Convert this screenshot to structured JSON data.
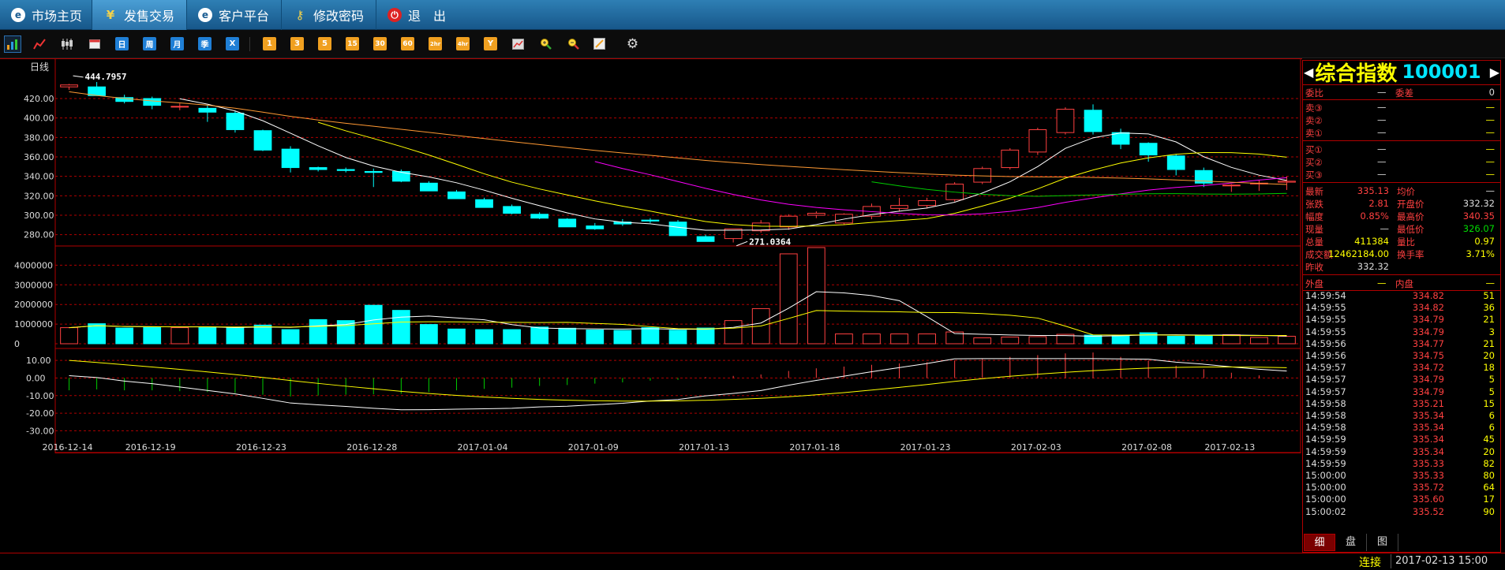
{
  "nav": {
    "items": [
      {
        "label": "市场主页",
        "icon": "market-home-icon"
      },
      {
        "label": "发售交易",
        "icon": "yen-icon"
      },
      {
        "label": "客户平台",
        "icon": "client-platform-icon"
      },
      {
        "label": "修改密码",
        "icon": "key-icon"
      },
      {
        "label": "退　出",
        "icon": "power-icon"
      }
    ],
    "active_index": 1
  },
  "toolbar": {
    "period_buttons": [
      "日",
      "周",
      "月",
      "季",
      "X"
    ],
    "minute_buttons": [
      "1",
      "3",
      "5",
      "15",
      "30",
      "60",
      "2hr",
      "4hr",
      "Y"
    ]
  },
  "chart_data": [
    {
      "type": "candlestick",
      "period_label": "日线",
      "x": [
        "2016-12-14",
        "2016-12-15",
        "2016-12-16",
        "2016-12-19",
        "2016-12-20",
        "2016-12-21",
        "2016-12-22",
        "2016-12-23",
        "2016-12-26",
        "2016-12-27",
        "2016-12-28",
        "2016-12-29",
        "2016-12-30",
        "2017-01-03",
        "2017-01-04",
        "2017-01-05",
        "2017-01-06",
        "2017-01-09",
        "2017-01-10",
        "2017-01-11",
        "2017-01-12",
        "2017-01-13",
        "2017-01-16",
        "2017-01-17",
        "2017-01-18",
        "2017-01-19",
        "2017-01-20",
        "2017-01-23",
        "2017-01-24",
        "2017-01-25",
        "2017-01-26",
        "2017-01-27",
        "2017-01-31",
        "2017-02-01",
        "2017-02-02",
        "2017-02-03",
        "2017-02-06",
        "2017-02-07",
        "2017-02-08",
        "2017-02-09",
        "2017-02-10",
        "2017-02-13"
      ],
      "x_tick_labels": [
        "2016-12-14",
        "2016-12-19",
        "2016-12-23",
        "2016-12-28",
        "2017-01-04",
        "2017-01-09",
        "2017-01-13",
        "2017-01-18",
        "2017-01-23",
        "2017-02-03",
        "2017-02-08",
        "2017-02-13"
      ],
      "x_tick_indices": [
        0,
        3,
        7,
        11,
        15,
        19,
        23,
        27,
        31,
        35,
        39,
        42
      ],
      "ylim": [
        270,
        450
      ],
      "yticks": [
        "420.00",
        "400.00",
        "380.00",
        "360.00",
        "340.00",
        "320.00",
        "300.00",
        "280.00"
      ],
      "ohlc": [
        [
          432,
          435,
          429,
          434
        ],
        [
          432,
          437,
          424,
          423
        ],
        [
          421,
          424,
          415,
          417
        ],
        [
          420,
          422,
          409,
          413
        ],
        [
          412,
          415,
          408,
          412
        ],
        [
          410,
          413,
          396,
          406
        ],
        [
          405,
          407,
          385,
          388
        ],
        [
          387,
          388,
          366,
          367
        ],
        [
          368,
          371,
          344,
          349
        ],
        [
          349,
          350,
          345,
          347
        ],
        [
          347,
          349,
          344,
          346
        ],
        [
          345,
          348,
          329,
          344
        ],
        [
          345,
          347,
          334,
          335
        ],
        [
          333,
          335,
          326,
          325
        ],
        [
          324,
          326,
          318,
          317
        ],
        [
          316,
          318,
          309,
          308
        ],
        [
          309,
          311,
          301,
          302
        ],
        [
          301,
          303,
          296,
          297
        ],
        [
          296,
          297,
          288,
          288
        ],
        [
          289,
          292,
          285,
          286
        ],
        [
          293,
          296,
          289,
          291
        ],
        [
          295,
          297,
          292,
          294
        ],
        [
          293,
          295,
          290,
          279
        ],
        [
          278,
          280,
          274,
          273
        ],
        [
          276,
          286,
          272,
          286
        ],
        [
          284,
          295,
          282,
          292
        ],
        [
          288,
          301,
          285,
          299
        ],
        [
          300,
          304,
          297,
          302
        ],
        [
          292,
          302,
          290,
          301
        ],
        [
          299,
          312,
          296,
          309
        ],
        [
          307,
          318,
          304,
          310
        ],
        [
          310,
          318,
          307,
          315
        ],
        [
          316,
          334,
          314,
          332
        ],
        [
          334,
          350,
          332,
          348
        ],
        [
          349,
          369,
          347,
          367
        ],
        [
          365,
          390,
          362,
          388
        ],
        [
          385,
          411,
          383,
          409
        ],
        [
          408,
          414,
          383,
          386
        ],
        [
          385,
          389,
          368,
          373
        ],
        [
          374,
          375,
          355,
          362
        ],
        [
          361,
          363,
          341,
          347
        ],
        [
          346,
          349,
          329,
          333
        ],
        [
          331,
          332,
          324,
          331
        ],
        [
          333,
          336,
          325,
          333
        ],
        [
          334,
          340,
          326,
          335
        ]
      ],
      "annotations": [
        {
          "label": "444.7957"
        },
        {
          "label": "271.0364"
        }
      ],
      "ma_series": [
        {
          "color": "#ffffff"
        },
        {
          "color": "#ffff00"
        },
        {
          "color": "#ff00ff"
        },
        {
          "color": "#00cc00"
        },
        {
          "color": "#ff9933"
        }
      ]
    },
    {
      "type": "bar",
      "yticks": [
        "4000000",
        "3000000",
        "2000000",
        "1000000",
        "0"
      ],
      "ylim": [
        0,
        4900000
      ],
      "values": [
        820000,
        1020000,
        800000,
        830000,
        820000,
        850000,
        820000,
        950000,
        720000,
        1230000,
        1180000,
        1960000,
        1700000,
        980000,
        750000,
        720000,
        720000,
        850000,
        790000,
        700000,
        680000,
        820000,
        690000,
        800000,
        1180000,
        1790000,
        4580000,
        4900000,
        500000,
        500000,
        500000,
        500000,
        600000,
        300000,
        340000,
        360000,
        480000,
        440000,
        420000,
        560000,
        380000,
        420000,
        460000,
        320000,
        380000
      ]
    },
    {
      "type": "macd",
      "yticks": [
        "10.00",
        "0.00",
        "-10.00",
        "-20.00",
        "-30.00"
      ],
      "ylim": [
        -37,
        15
      ],
      "histogram": [
        -7,
        -6.5,
        -7,
        -7,
        -7.5,
        -8,
        -8.5,
        -9.5,
        -10.5,
        -10,
        -9.5,
        -9.3,
        -9,
        -8,
        -7,
        -6.2,
        -5.5,
        -4.5,
        -4,
        -3.2,
        -2.5,
        -1.5,
        -1,
        0.5,
        1.2,
        2,
        4,
        5.5,
        6.5,
        7.5,
        8.3,
        9,
        10,
        11,
        12,
        13,
        14,
        14.5,
        12,
        10,
        7,
        5,
        3,
        1.5,
        0.5
      ]
    }
  ],
  "quote": {
    "title": "综合指数",
    "code": "100001",
    "weibi": {
      "label1": "委比",
      "val1": "—",
      "label2": "委差",
      "val2": "0"
    },
    "asks": [
      {
        "label": "卖③",
        "price": "—",
        "vol": "—"
      },
      {
        "label": "卖②",
        "price": "—",
        "vol": "—"
      },
      {
        "label": "卖①",
        "price": "—",
        "vol": "—"
      }
    ],
    "bids": [
      {
        "label": "买①",
        "price": "—",
        "vol": "—"
      },
      {
        "label": "买②",
        "price": "—",
        "vol": "—"
      },
      {
        "label": "买③",
        "price": "—",
        "vol": "—"
      }
    ],
    "stats": [
      {
        "l1": "最新",
        "v1": "335.13",
        "l2": "均价",
        "v2": "—",
        "c1": "#ff4040",
        "c2": "#dddddd"
      },
      {
        "l1": "张跌",
        "v1": "2.81",
        "l2": "开盘价",
        "v2": "332.32",
        "c1": "#ff4040",
        "c2": "#dddddd"
      },
      {
        "l1": "幅度",
        "v1": "0.85%",
        "l2": "最高价",
        "v2": "340.35",
        "c1": "#ff4040",
        "c2": "#ff4040"
      },
      {
        "l1": "现量",
        "v1": "—",
        "l2": "最低价",
        "v2": "326.07",
        "c1": "#dddddd",
        "c2": "#00dd00"
      },
      {
        "l1": "总量",
        "v1": "411384",
        "l2": "量比",
        "v2": "0.97",
        "c1": "#ffff00",
        "c2": "#ffff00"
      },
      {
        "l1": "成交额",
        "v1": "12462184.00",
        "l2": "换手率",
        "v2": "3.71%",
        "c1": "#ffff00",
        "c2": "#ffff00"
      },
      {
        "l1": "昨收",
        "v1": "332.32",
        "l2": "",
        "v2": "",
        "c1": "#dddddd",
        "c2": "#dddddd"
      }
    ],
    "waipan": {
      "l1": "外盘",
      "v1": "—",
      "l2": "内盘",
      "v2": "—"
    },
    "ticks": [
      {
        "t": "14:59:54",
        "p": "334.82",
        "v": "51"
      },
      {
        "t": "14:59:55",
        "p": "334.82",
        "v": "36"
      },
      {
        "t": "14:59:55",
        "p": "334.79",
        "v": "21"
      },
      {
        "t": "14:59:55",
        "p": "334.79",
        "v": "3"
      },
      {
        "t": "14:59:56",
        "p": "334.77",
        "v": "21"
      },
      {
        "t": "14:59:56",
        "p": "334.75",
        "v": "20"
      },
      {
        "t": "14:59:57",
        "p": "334.72",
        "v": "18"
      },
      {
        "t": "14:59:57",
        "p": "334.79",
        "v": "5"
      },
      {
        "t": "14:59:57",
        "p": "334.79",
        "v": "5"
      },
      {
        "t": "14:59:58",
        "p": "335.21",
        "v": "15"
      },
      {
        "t": "14:59:58",
        "p": "335.34",
        "v": "6"
      },
      {
        "t": "14:59:58",
        "p": "335.34",
        "v": "6"
      },
      {
        "t": "14:59:59",
        "p": "335.34",
        "v": "45"
      },
      {
        "t": "14:59:59",
        "p": "335.34",
        "v": "20"
      },
      {
        "t": "14:59:59",
        "p": "335.33",
        "v": "82"
      },
      {
        "t": "15:00:00",
        "p": "335.33",
        "v": "80"
      },
      {
        "t": "15:00:00",
        "p": "335.72",
        "v": "64"
      },
      {
        "t": "15:00:00",
        "p": "335.60",
        "v": "17"
      },
      {
        "t": "15:00:02",
        "p": "335.52",
        "v": "90"
      }
    ],
    "tabs": [
      "细",
      "盘",
      "图"
    ]
  },
  "status": {
    "connection": "连接",
    "datetime": "2017-02-13 15:00"
  },
  "colors": {
    "up": "#ff4040",
    "down": "#00ffff",
    "grid": "#b00000",
    "accent_yellow": "#ffff00"
  }
}
